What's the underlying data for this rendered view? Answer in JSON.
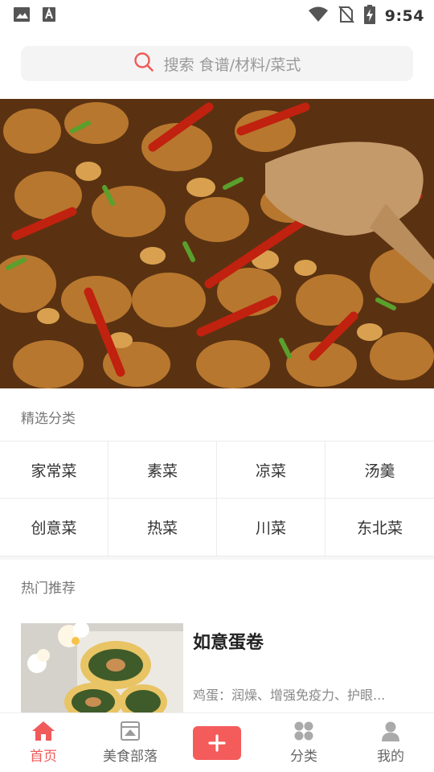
{
  "status_bar": {
    "time": "9:54",
    "icons": [
      "image-icon",
      "text-a-icon",
      "wifi-icon",
      "no-sim-icon",
      "battery-charging-icon"
    ]
  },
  "search": {
    "placeholder": "搜索 食谱/材料/菜式"
  },
  "banner": {
    "image": "kung-pao-chicken-photo"
  },
  "featured_categories": {
    "title": "精选分类",
    "items": [
      "家常菜",
      "素菜",
      "凉菜",
      "汤羹",
      "创意菜",
      "热菜",
      "川菜",
      "东北菜"
    ]
  },
  "hot_recommend": {
    "title": "热门推荐",
    "items": [
      {
        "title": "如意蛋卷",
        "desc": "鸡蛋：润燥、增强免疫力、护眼...",
        "image": "egg-roll-photo"
      }
    ]
  },
  "tabbar": {
    "items": [
      {
        "label": "首页",
        "icon": "home-icon",
        "active": true
      },
      {
        "label": "美食部落",
        "icon": "tribe-icon",
        "active": false
      },
      {
        "label": "",
        "icon": "plus-icon",
        "active": false
      },
      {
        "label": "分类",
        "icon": "category-icon",
        "active": false
      },
      {
        "label": "我的",
        "icon": "person-icon",
        "active": false
      }
    ]
  },
  "colors": {
    "accent": "#f05a5a",
    "search_bg": "#f4f4f4",
    "muted_text": "#777777"
  }
}
